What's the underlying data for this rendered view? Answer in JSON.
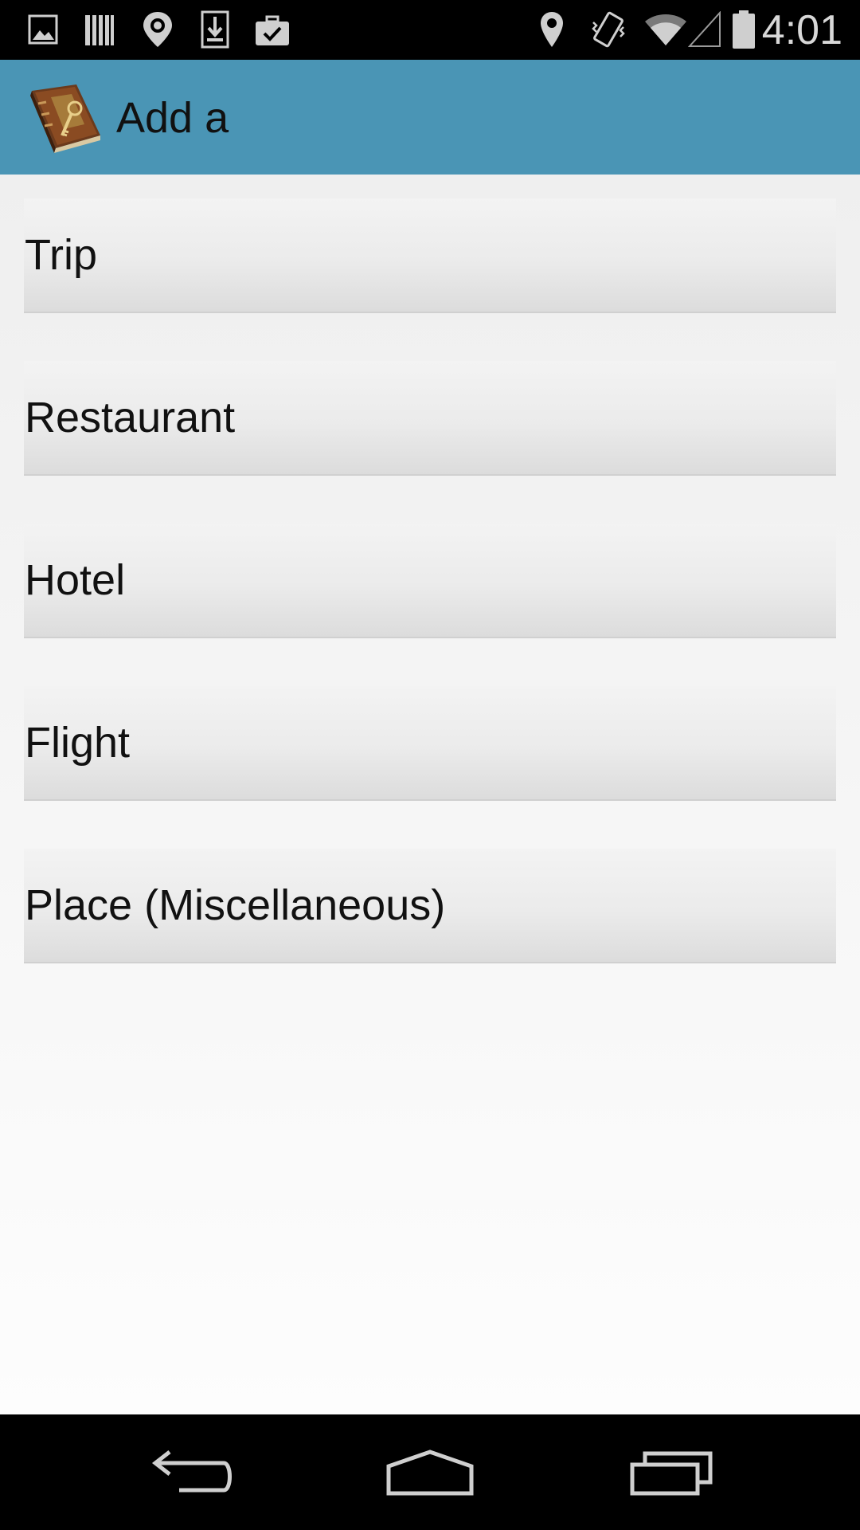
{
  "status_bar": {
    "time": "4:01",
    "left_icons": [
      "image-icon",
      "barcode-icon",
      "location-pin-icon",
      "download-icon",
      "briefcase-check-icon"
    ],
    "right_icons": [
      "location-icon",
      "vibrate-icon",
      "wifi-icon",
      "signal-icon",
      "battery-icon"
    ]
  },
  "app_bar": {
    "title": "Add a",
    "icon": "journal-book-icon",
    "color": "#4a95b5"
  },
  "options": [
    {
      "label": "Trip"
    },
    {
      "label": "Restaurant"
    },
    {
      "label": "Hotel"
    },
    {
      "label": "Flight"
    },
    {
      "label": "Place (Miscellaneous)"
    }
  ],
  "nav_bar": {
    "buttons": [
      "back-icon",
      "home-icon",
      "recents-icon"
    ]
  }
}
